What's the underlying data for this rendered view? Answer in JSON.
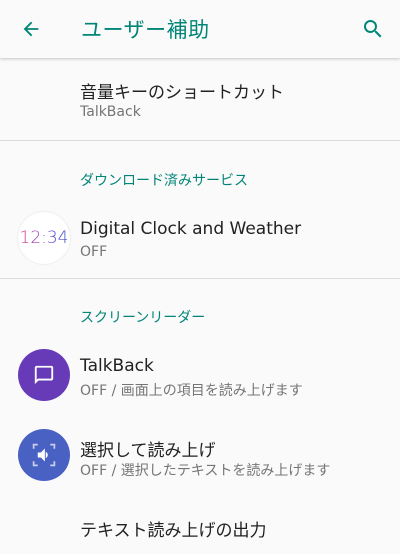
{
  "appbar": {
    "title": "ユーザー補助",
    "back_icon": "arrow-back-icon",
    "search_icon": "search-icon",
    "accent_color": "#008577"
  },
  "items": {
    "volume_shortcut": {
      "title": "音量キーのショートカット",
      "subtitle": "TalkBack"
    },
    "digital_clock": {
      "title": "Digital Clock and Weather",
      "subtitle": "OFF",
      "icon_text": "12:34"
    },
    "talkback": {
      "title": "TalkBack",
      "subtitle": "OFF / 画面上の項目を読み上げます"
    },
    "select_to_speak": {
      "title": "選択して読み上げ",
      "subtitle": "OFF / 選択したテキストを読み上げます"
    },
    "tts_output": {
      "title": "テキスト読み上げの出力"
    }
  },
  "sections": {
    "downloaded": "ダウンロード済みサービス",
    "screen_reader": "スクリーンリーダー"
  },
  "colors": {
    "talkback_icon_bg": "#673ab7",
    "select_to_speak_icon_bg": "#4a61c4"
  }
}
